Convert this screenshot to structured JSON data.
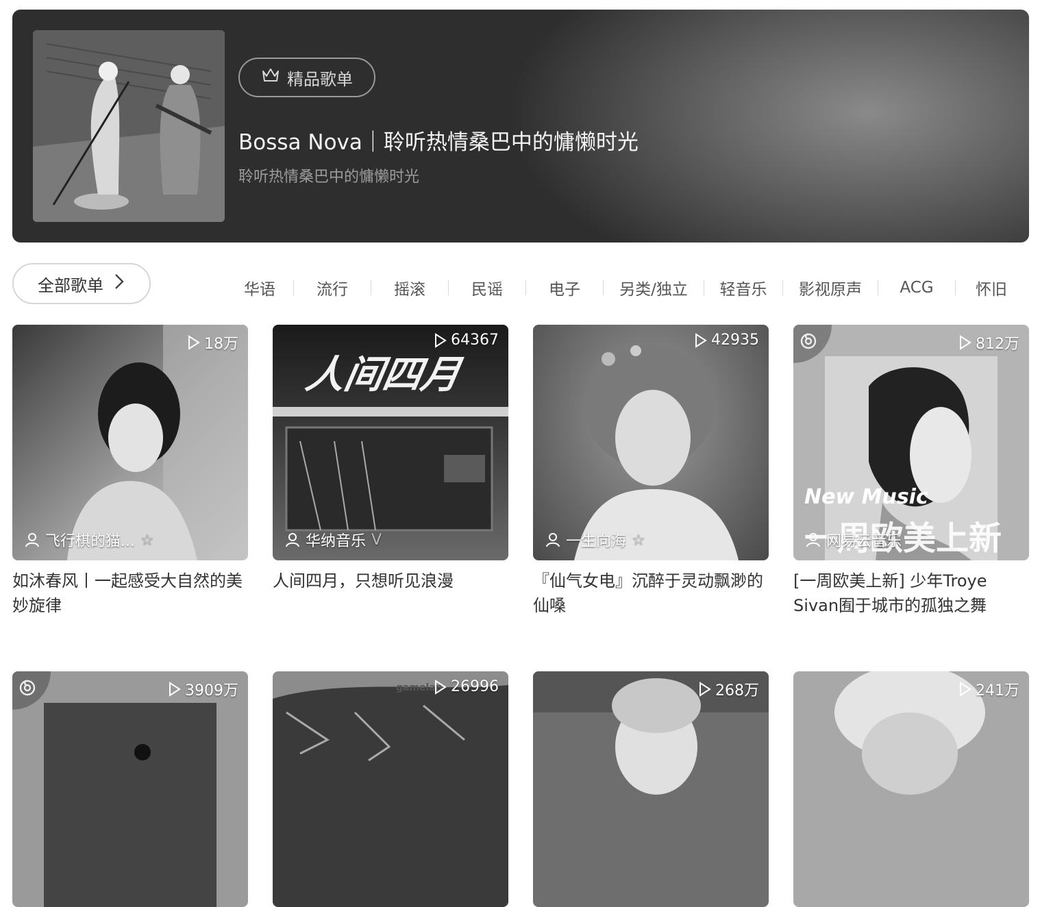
{
  "banner": {
    "badge_label": "精品歌单",
    "badge_icon": "crown-icon",
    "title": "Bossa Nova｜聆听热情桑巴中的慵懒时光",
    "subtitle": "聆听热情桑巴中的慵懒时光"
  },
  "filters": {
    "all_label": "全部歌单",
    "categories": [
      "华语",
      "流行",
      "摇滚",
      "民谣",
      "电子",
      "另类/独立",
      "轻音乐",
      "影视原声",
      "ACG",
      "怀旧"
    ]
  },
  "playlists": [
    {
      "plays": "18万",
      "creator": "飞行棋的猫...",
      "creator_mark": "☆",
      "title": "如沐春风丨一起感受大自然的美妙旋律"
    },
    {
      "plays": "64367",
      "creator": "华纳音乐",
      "creator_mark": "V",
      "title": "人间四月，只想听见浪漫",
      "cover_text": "人间四月"
    },
    {
      "plays": "42935",
      "creator": "一生向海",
      "creator_mark": "☆",
      "title": "『仙气女电』沉醉于灵动飘渺的仙嗓"
    },
    {
      "plays": "812万",
      "creator": "网易云音乐",
      "creator_mark": "",
      "title": "[一周欧美上新] 少年Troye Sivan囿于城市的孤独之舞",
      "cover_text_1": "New Music",
      "cover_text_2": "一周欧美上新"
    },
    {
      "plays": "3909万"
    },
    {
      "plays": "26996",
      "cover_text": "gamelan"
    },
    {
      "plays": "268万"
    },
    {
      "plays": "241万"
    }
  ]
}
